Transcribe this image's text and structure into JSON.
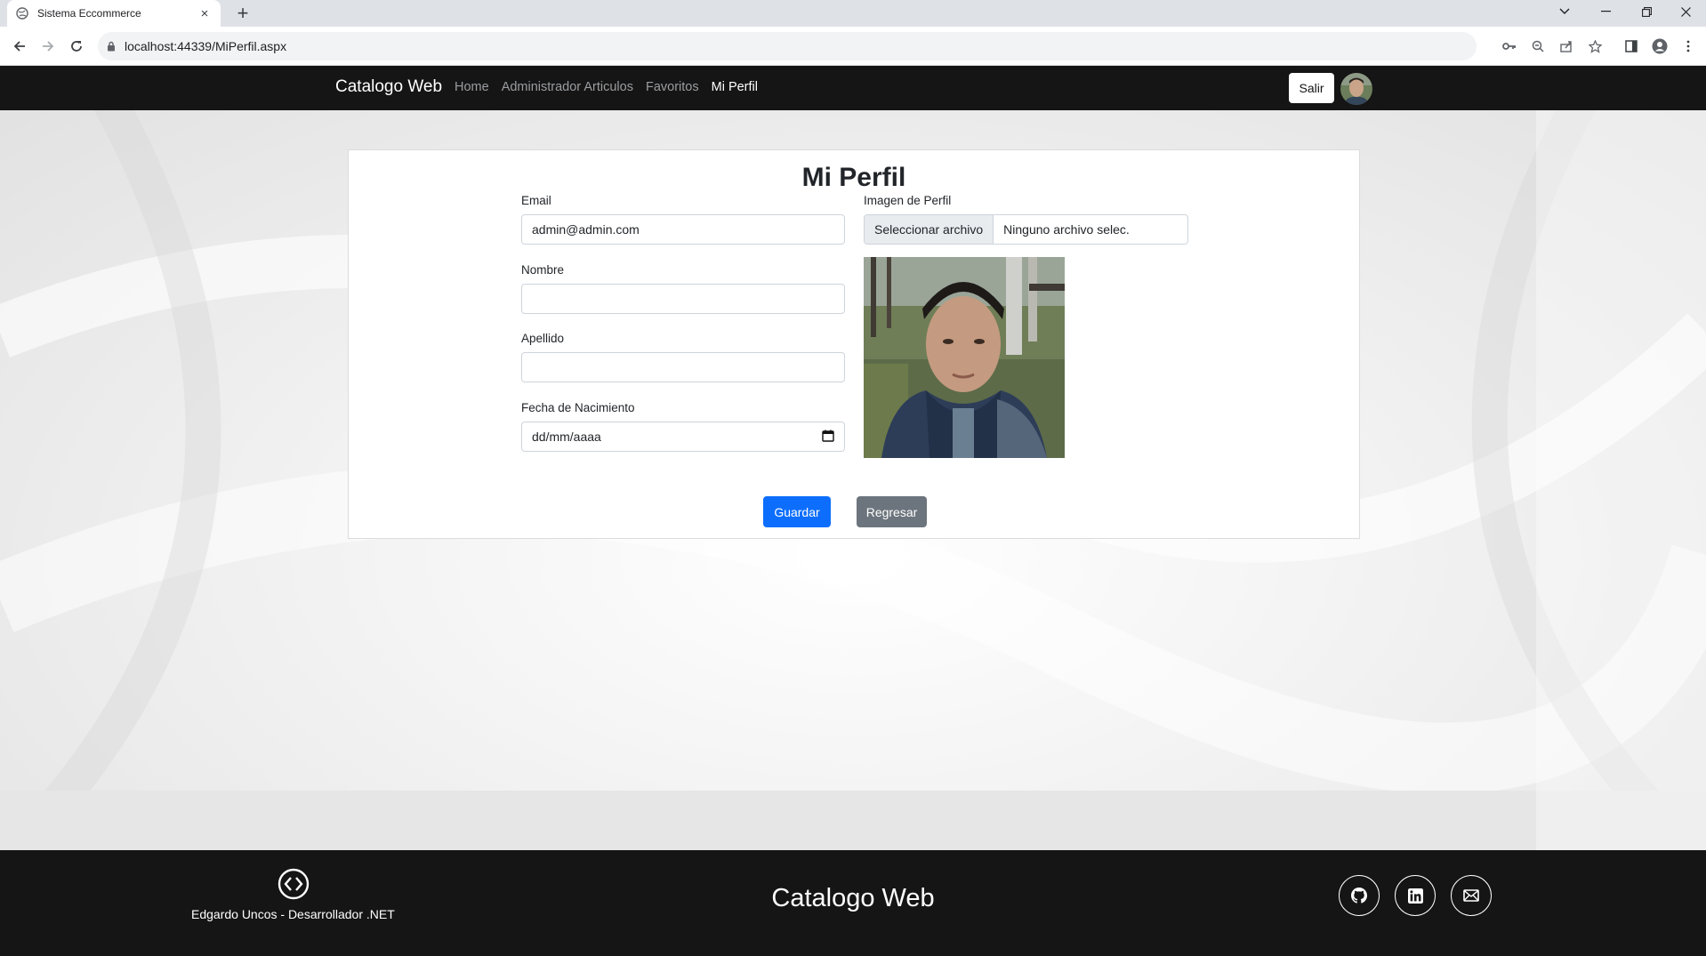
{
  "browser": {
    "tab_title": "Sistema Eccommerce",
    "tab_close": "×",
    "new_tab": "+",
    "url": "localhost:44339/MiPerfil.aspx"
  },
  "navbar": {
    "brand": "Catalogo Web",
    "links": [
      {
        "label": "Home",
        "active": false
      },
      {
        "label": "Administrador Articulos",
        "active": false
      },
      {
        "label": "Favoritos",
        "active": false
      },
      {
        "label": "Mi Perfil",
        "active": true
      }
    ],
    "logout_label": "Salir"
  },
  "profile": {
    "title": "Mi Perfil",
    "email_label": "Email",
    "email_value": "admin@admin.com",
    "nombre_label": "Nombre",
    "nombre_value": "",
    "apellido_label": "Apellido",
    "apellido_value": "",
    "fecha_label": "Fecha de Nacimiento",
    "fecha_placeholder": "dd/mm/aaaa",
    "imagen_label": "Imagen de Perfil",
    "file_button": "Seleccionar archivo",
    "file_status": "Ninguno archivo selec.",
    "save_label": "Guardar",
    "back_label": "Regresar"
  },
  "footer": {
    "author": "Edgardo Uncos - Desarrollador .NET",
    "title": "Catalogo Web",
    "social_icons": [
      "github-icon",
      "linkedin-icon",
      "email-icon"
    ]
  },
  "colors": {
    "primary": "#0d6efd",
    "secondary": "#6c757d",
    "navbar_bg": "#151515"
  }
}
